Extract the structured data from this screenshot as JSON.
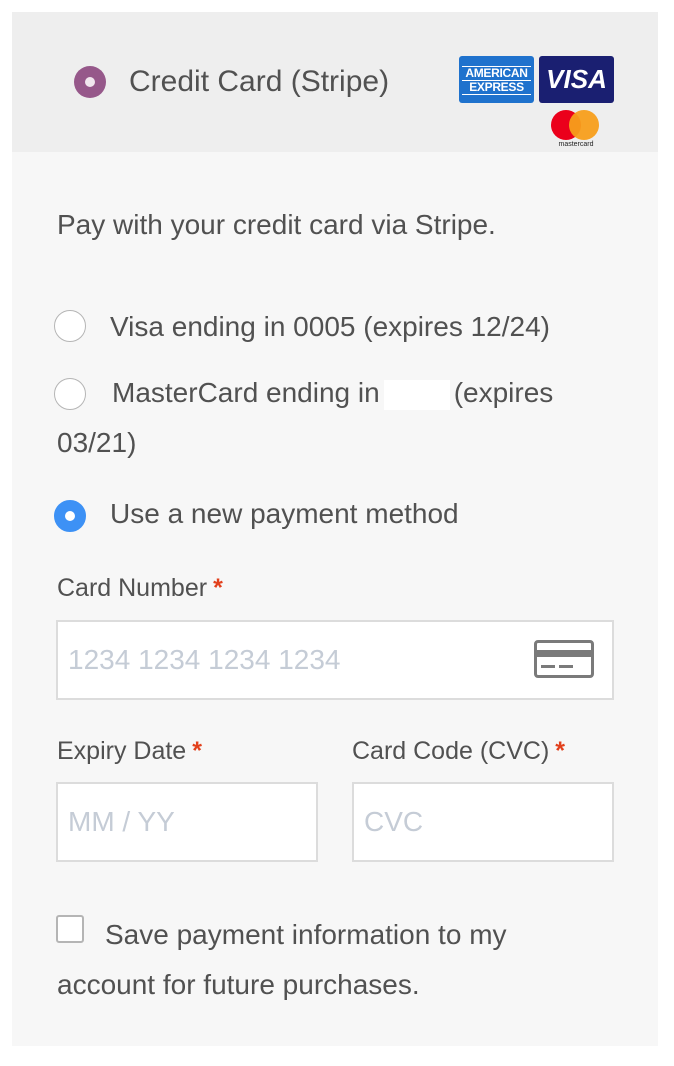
{
  "method": {
    "label": "Credit Card (Stripe)",
    "selected": true,
    "logos": [
      {
        "name": "american-express",
        "text_line1": "AMERICAN",
        "text_line2": "EXPRESS",
        "color": "#1f72cd"
      },
      {
        "name": "visa",
        "text": "VISA",
        "color": "#1a1f71"
      },
      {
        "name": "mastercard",
        "text": "mastercard",
        "colors": [
          "#eb001b",
          "#f79e1b"
        ]
      }
    ]
  },
  "description": "Pay with your credit card via Stripe.",
  "saved_methods": [
    {
      "text": "Visa ending in 0005 (expires 12/24)",
      "selected": false
    },
    {
      "text_before": "MasterCard ending in",
      "text_after": "(expires",
      "text_line2": "03/21)",
      "selected": false
    },
    {
      "text": "Use a new payment method",
      "selected": true
    }
  ],
  "fields": {
    "card_number": {
      "label": "Card Number",
      "required": "*",
      "placeholder": "1234 1234 1234 1234",
      "value": ""
    },
    "expiry": {
      "label": "Expiry Date",
      "required": "*",
      "placeholder": "MM / YY",
      "value": ""
    },
    "cvc": {
      "label": "Card Code (CVC)",
      "required": "*",
      "placeholder": "CVC",
      "value": ""
    }
  },
  "save_payment": {
    "label": "Save payment information to my account for future purchases.",
    "checked": false
  },
  "colors": {
    "accent_purple": "#96588a",
    "radio_selected": "#3d91f5",
    "required_star": "#e2401c",
    "panel_bg": "#f7f7f7"
  }
}
